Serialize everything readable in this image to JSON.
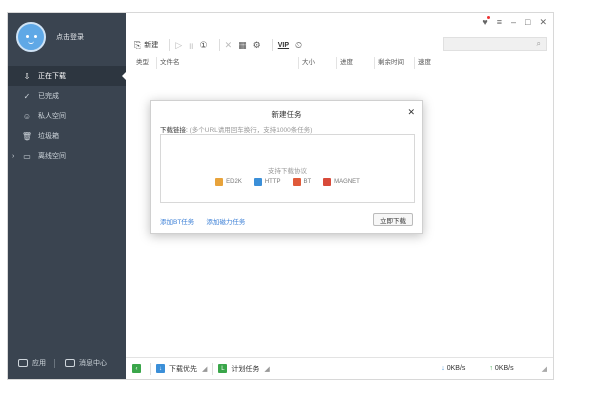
{
  "user": {
    "login_text": "点击登录"
  },
  "sidebar": {
    "items": [
      {
        "label": "正在下载",
        "icon": "download-icon",
        "active": true
      },
      {
        "label": "已完成",
        "icon": "check-circle-icon",
        "active": false
      },
      {
        "label": "私人空间",
        "icon": "person-lock-icon",
        "active": false
      },
      {
        "label": "垃圾箱",
        "icon": "trash-icon",
        "active": false
      },
      {
        "label": "离线空间",
        "icon": "cloud-folder-icon",
        "active": false
      }
    ],
    "bottom": {
      "apps_label": "应用",
      "messages_label": "消息中心"
    }
  },
  "toolbar": {
    "new_label": "新建",
    "vip_label": "VIP"
  },
  "table": {
    "columns": [
      "类型",
      "文件名",
      "大小",
      "进度",
      "剩余时间",
      "速度"
    ]
  },
  "statusbar": {
    "priority_label": "下载优先",
    "schedule_label": "计划任务",
    "download_speed": "0KB/s",
    "upload_speed": "0KB/s"
  },
  "dialog": {
    "title": "新建任务",
    "link_label": "下载链接:",
    "link_hint": "(多个URL请用回车换行，支持1000条任务)",
    "protocols_title": "支持下载协议",
    "protocols": [
      {
        "name": "ED2K",
        "color": "#e8a33b"
      },
      {
        "name": "HTTP",
        "color": "#3b8fd8"
      },
      {
        "name": "BT",
        "color": "#e05a3a"
      },
      {
        "name": "MAGNET",
        "color": "#d84a3a"
      }
    ],
    "add_bt_label": "添加BT任务",
    "add_magnet_label": "添加磁力任务",
    "start_button": "立即下载"
  },
  "colors": {
    "sidebar_bg": "#3a4450",
    "accent": "#3b7fd6"
  }
}
